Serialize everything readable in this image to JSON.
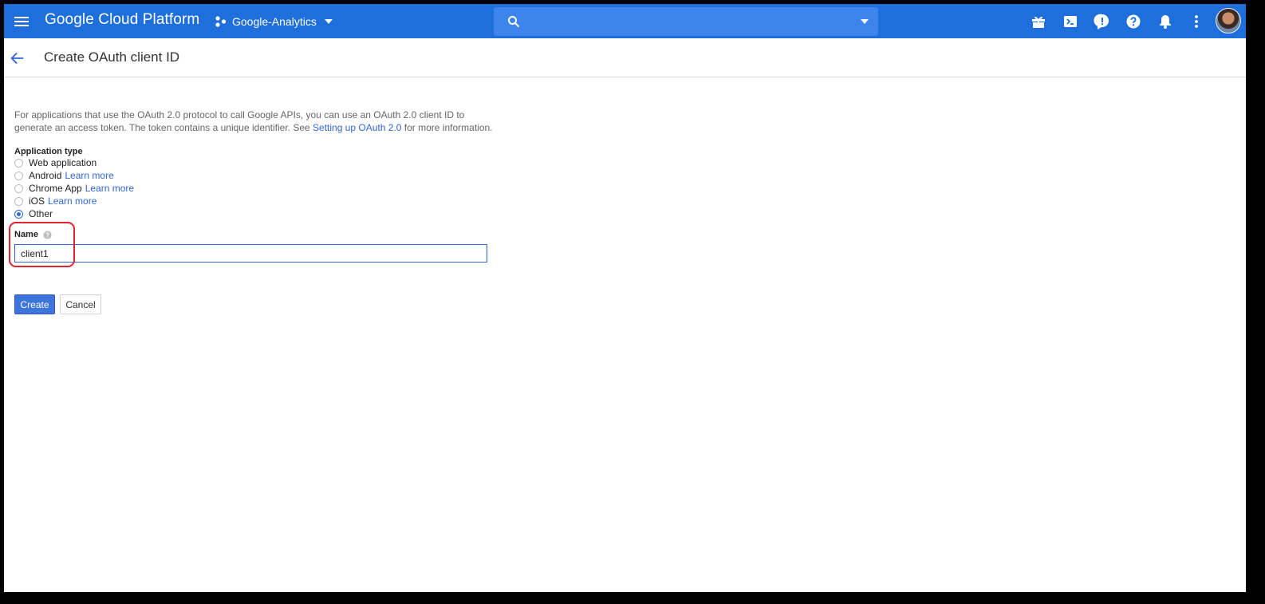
{
  "appbar": {
    "brand": "Google Cloud Platform",
    "project_name": "Google-Analytics",
    "icons": [
      "menu-icon",
      "project-dots-icon",
      "search-icon",
      "gift-icon",
      "cloud-shell-icon",
      "feedback-icon",
      "help-icon",
      "notifications-icon",
      "more-vert-icon"
    ],
    "color": "#1e6fdc"
  },
  "page": {
    "title": "Create OAuth client ID"
  },
  "form": {
    "description_line1": "For applications that use the OAuth 2.0 protocol to call Google APIs, you can use an OAuth 2.0 client ID to",
    "description_line2_pre": "generate an access token. The token contains a unique identifier. See ",
    "description_link": "Setting up OAuth 2.0",
    "description_line2_post": " for more information.",
    "application_type_label": "Application type",
    "application_types": [
      {
        "label": "Web application",
        "link": "",
        "checked": false
      },
      {
        "label": "Android",
        "link": "Learn more",
        "checked": false
      },
      {
        "label": "Chrome App",
        "link": "Learn more",
        "checked": false
      },
      {
        "label": "iOS",
        "link": "Learn more",
        "checked": false
      },
      {
        "label": "Other",
        "link": "",
        "checked": true
      }
    ],
    "name_label": "Name",
    "name_value": "client1",
    "create_label": "Create",
    "cancel_label": "Cancel",
    "accent_color": "#3367d6",
    "highlight_color": "#e0242f"
  }
}
